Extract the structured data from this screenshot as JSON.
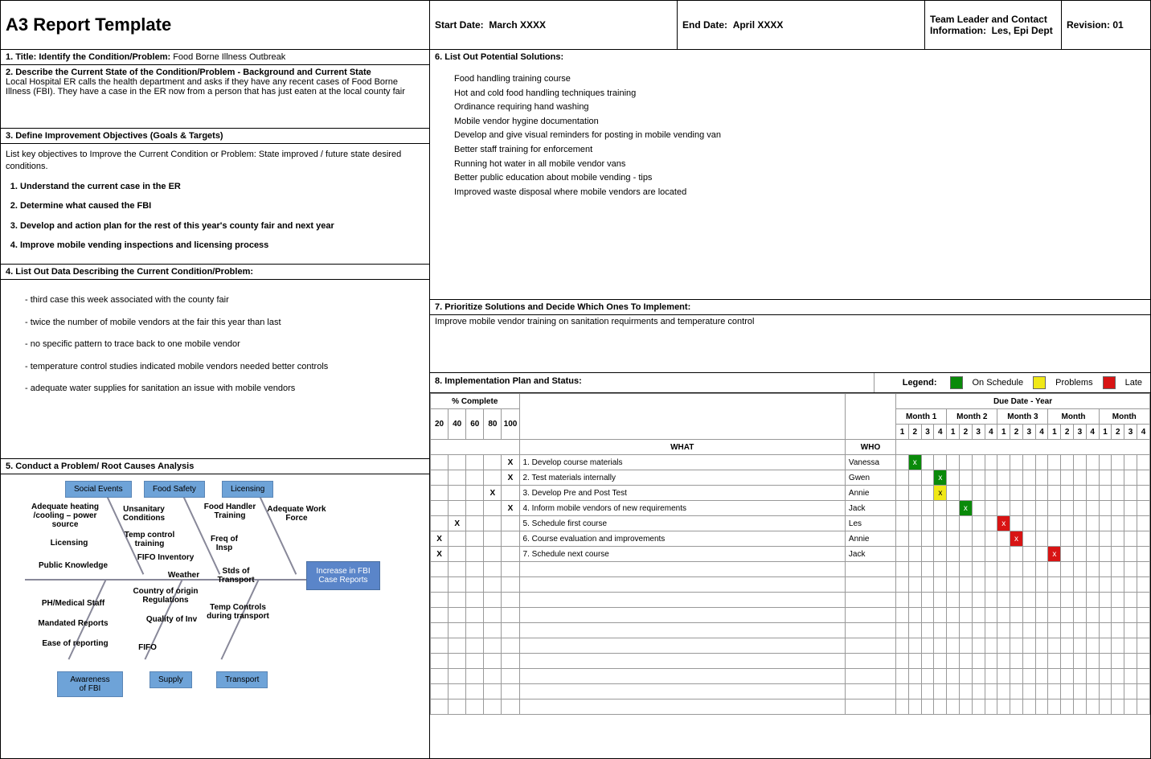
{
  "header": {
    "title": "A3 Report Template",
    "start_date_label": "Start Date:",
    "start_date": "March XXXX",
    "end_date_label": "End Date:",
    "end_date": "April XXXX",
    "leader_label": "Team Leader and Contact Information:",
    "leader": "Les, Epi Dept",
    "revision_label": "Revision:",
    "revision": "01"
  },
  "s1": {
    "heading": "1. Title: Identify the Condition/Problem:",
    "value": "Food Borne Illness Outbreak"
  },
  "s2": {
    "heading": "2. Describe the Current State of the Condition/Problem - Background and Current State",
    "body": "Local Hospital ER calls the health department and asks if they have any recent cases of Food Borne Illness (FBI). They have a case in the ER now from a person that has just eaten at the local county fair"
  },
  "s3": {
    "heading": "3. Define Improvement Objectives (Goals & Targets)",
    "intro": "List key objectives to Improve the Current Condition or Problem: State improved / future state desired conditions.",
    "items": [
      "Understand the current case in the ER",
      "Determine what caused the FBI",
      "Develop and action plan for the rest of this year's county fair and next year",
      "Improve mobile vending inspections and licensing process"
    ]
  },
  "s4": {
    "heading": "4. List Out Data Describing the Current Condition/Problem:",
    "items": [
      "- third case this week associated with the county fair",
      "- twice the number of mobile vendors at the fair this year than last",
      "- no specific pattern to trace back to one mobile vendor",
      "- temperature control studies indicated mobile vendors needed better controls",
      "- adequate water supplies for sanitation an issue with mobile vendors"
    ]
  },
  "s5": {
    "heading": "5. Conduct a Problem/ Root Causes Analysis",
    "categories_top": [
      "Social Events",
      "Food Safety",
      "Licensing"
    ],
    "categories_bottom": [
      "Awareness of FBI",
      "Supply",
      "Transport"
    ],
    "outcome": "Increase in FBI Case Reports",
    "causes_top": [
      "Adequate heating /cooling – power source",
      "Unsanitary Conditions",
      "Food Handler Training",
      "Adequate Work Force",
      "Licensing",
      "Temp control training",
      "Freq of Insp",
      "Public Knowledge",
      "FIFO Inventory",
      "Weather",
      "Country of origin Regulations",
      "Stds of Transport",
      "PH/Medical Staff",
      "Mandated Reports",
      "Quality of Inv",
      "Temp Controls during transport",
      "Ease of reporting",
      "FIFO"
    ]
  },
  "s6": {
    "heading": "6. List Out Potential Solutions:",
    "items": [
      "Food handling training course",
      "Hot and cold food handling techniques training",
      "Ordinance requiring hand washing",
      "Mobile vendor hygine documentation",
      "Develop and give visual reminders for posting in mobile vending van",
      "Better staff training for enforcement",
      "Running hot water in all mobile vendor vans",
      "Better public education about mobile vending - tips",
      "Improved waste disposal where mobile vendors are located"
    ]
  },
  "s7": {
    "heading": "7. Prioritize Solutions and Decide Which Ones To Implement:",
    "body": "Improve mobile vendor training on sanitation requirments and temperature control"
  },
  "s8": {
    "heading": "8. Implementation Plan and Status:",
    "legend_label": "Legend:",
    "legend": [
      "On Schedule",
      "Problems",
      "Late"
    ],
    "pct_header": "% Complete",
    "pct_cols": [
      "20",
      "40",
      "60",
      "80",
      "100"
    ],
    "due_header": "Due Date - Year",
    "months": [
      "Month 1",
      "Month 2",
      "Month 3",
      "Month",
      "Month"
    ],
    "weeks": [
      "1",
      "2",
      "3",
      "4"
    ],
    "what_header": "WHAT",
    "who_header": "WHO",
    "tasks": [
      {
        "pct": "100",
        "what": "1. Develop course materials",
        "who": "Vanessa",
        "month": 1,
        "week": 2,
        "status": "g"
      },
      {
        "pct": "100",
        "what": "2. Test materials internally",
        "who": "Gwen",
        "month": 1,
        "week": 4,
        "status": "g"
      },
      {
        "pct": "80",
        "what": "3. Develop Pre and Post Test",
        "who": "Annie",
        "month": 1,
        "week": 4,
        "status": "y"
      },
      {
        "pct": "100",
        "what": "4. Inform mobile vendors of new requirements",
        "who": "Jack",
        "month": 2,
        "week": 2,
        "status": "g"
      },
      {
        "pct": "40",
        "what": "5. Schedule first course",
        "who": "Les",
        "month": 3,
        "week": 1,
        "status": "r"
      },
      {
        "pct": "20",
        "what": "6. Course evaluation and improvements",
        "who": "Annie",
        "month": 3,
        "week": 2,
        "status": "r"
      },
      {
        "pct": "20",
        "what": "7. Schedule next course",
        "who": "Jack",
        "month": 4,
        "week": 1,
        "status": "r"
      }
    ]
  }
}
